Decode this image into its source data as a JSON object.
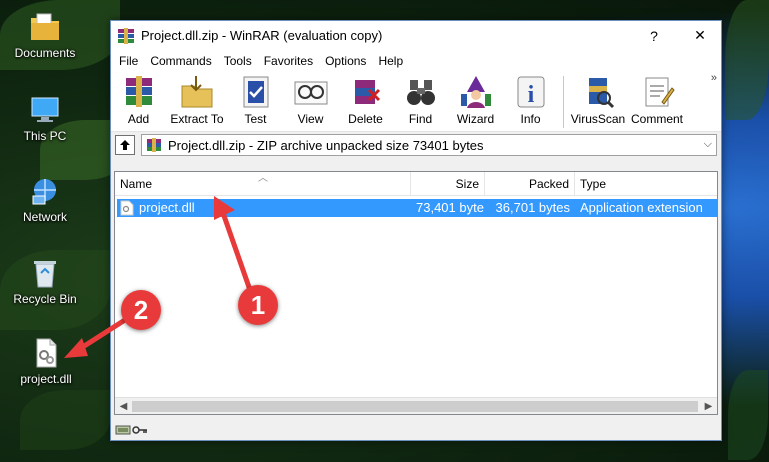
{
  "desktop": {
    "icons": [
      {
        "label": "Documents"
      },
      {
        "label": "This PC"
      },
      {
        "label": "Network"
      },
      {
        "label": "Recycle Bin"
      },
      {
        "label": "project.dll"
      }
    ]
  },
  "window": {
    "title": "Project.dll.zip - WinRAR (evaluation copy)",
    "help_btn": "?",
    "close_btn": "✕",
    "menu": [
      "File",
      "Commands",
      "Tools",
      "Favorites",
      "Options",
      "Help"
    ],
    "toolbar": [
      "Add",
      "Extract To",
      "Test",
      "View",
      "Delete",
      "Find",
      "Wizard",
      "Info",
      "VirusScan",
      "Comment"
    ],
    "toolbar_more": "»",
    "path": "Project.dll.zip - ZIP archive unpacked size 73401 bytes",
    "columns": {
      "name": "Name",
      "size": "Size",
      "packed": "Packed",
      "type": "Type"
    },
    "rows": [
      {
        "name": "project.dll",
        "size": "73,401 byte",
        "packed": "36,701 bytes",
        "type": "Application extension"
      }
    ]
  },
  "annotations": {
    "one": "1",
    "two": "2",
    "color": "#e83a3a"
  }
}
